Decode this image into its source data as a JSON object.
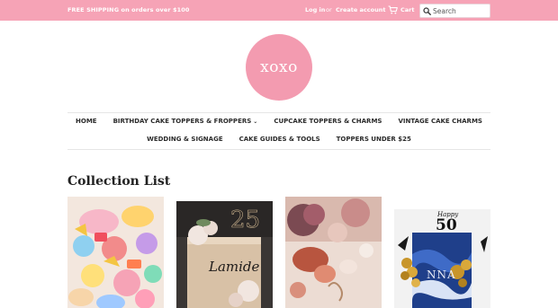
{
  "topbar": {
    "promo": "FREE SHIPPING on orders over $100",
    "login": "Log in",
    "or": "or",
    "create_account": "Create account",
    "cart": "Cart",
    "cart_icon": "cart-icon",
    "search_icon": "search-icon",
    "search_placeholder": "Search"
  },
  "logo": {
    "text": "xoxo"
  },
  "nav": {
    "row1": [
      {
        "label": "HOME",
        "dropdown": false
      },
      {
        "label": "BIRTHDAY CAKE TOPPERS & FROPPERS",
        "dropdown": true
      },
      {
        "label": "CUPCAKE TOPPERS & CHARMS",
        "dropdown": false
      },
      {
        "label": "VINTAGE CAKE CHARMS",
        "dropdown": false
      }
    ],
    "row2": [
      {
        "label": "WEDDING & SIGNAGE"
      },
      {
        "label": "CAKE GUIDES & TOOLS"
      },
      {
        "label": "TOPPERS UNDER $25"
      }
    ]
  },
  "collection": {
    "heading": "Collection List",
    "tiles": [
      {
        "kind": "colorful-number-cake"
      },
      {
        "kind": "gold-name-cake",
        "topper_number": "25",
        "topper_name": "Lamide"
      },
      {
        "kind": "floral-initial-cake"
      },
      {
        "kind": "blue-fifty-cake",
        "topper_top": "Happy",
        "topper_number": "50",
        "cake_letters": "NNA"
      }
    ]
  },
  "colors": {
    "brand_pink": "#f6a3b6",
    "logo_pink": "#f39bb0",
    "nav_text": "#2b2b2b"
  }
}
